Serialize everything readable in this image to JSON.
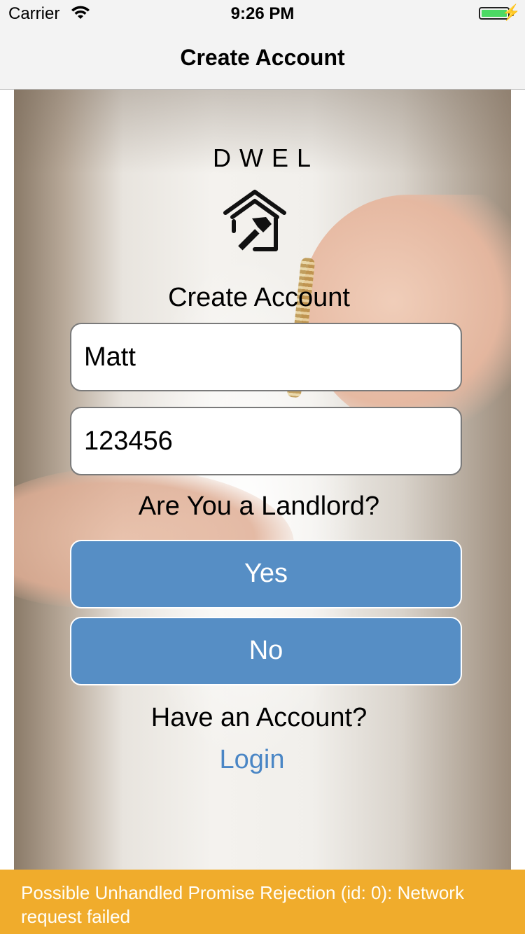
{
  "status_bar": {
    "carrier": "Carrier",
    "time": "9:26 PM",
    "battery_color": "#4cd964"
  },
  "nav": {
    "title": "Create Account"
  },
  "brand": "DWEL",
  "logo_icon": "house-hammer-icon",
  "form": {
    "heading": "Create Account",
    "name_value": "Matt",
    "password_value": "123456",
    "question": "Are You a Landlord?",
    "yes_label": "Yes",
    "no_label": "No",
    "button_color": "#568ec5"
  },
  "footer": {
    "have_account": "Have an Account?",
    "login_label": "Login",
    "link_color": "#4a86c5"
  },
  "warning": {
    "message": "Possible Unhandled Promise Rejection (id: 0): Network request failed",
    "color": "#f0ac2c"
  }
}
